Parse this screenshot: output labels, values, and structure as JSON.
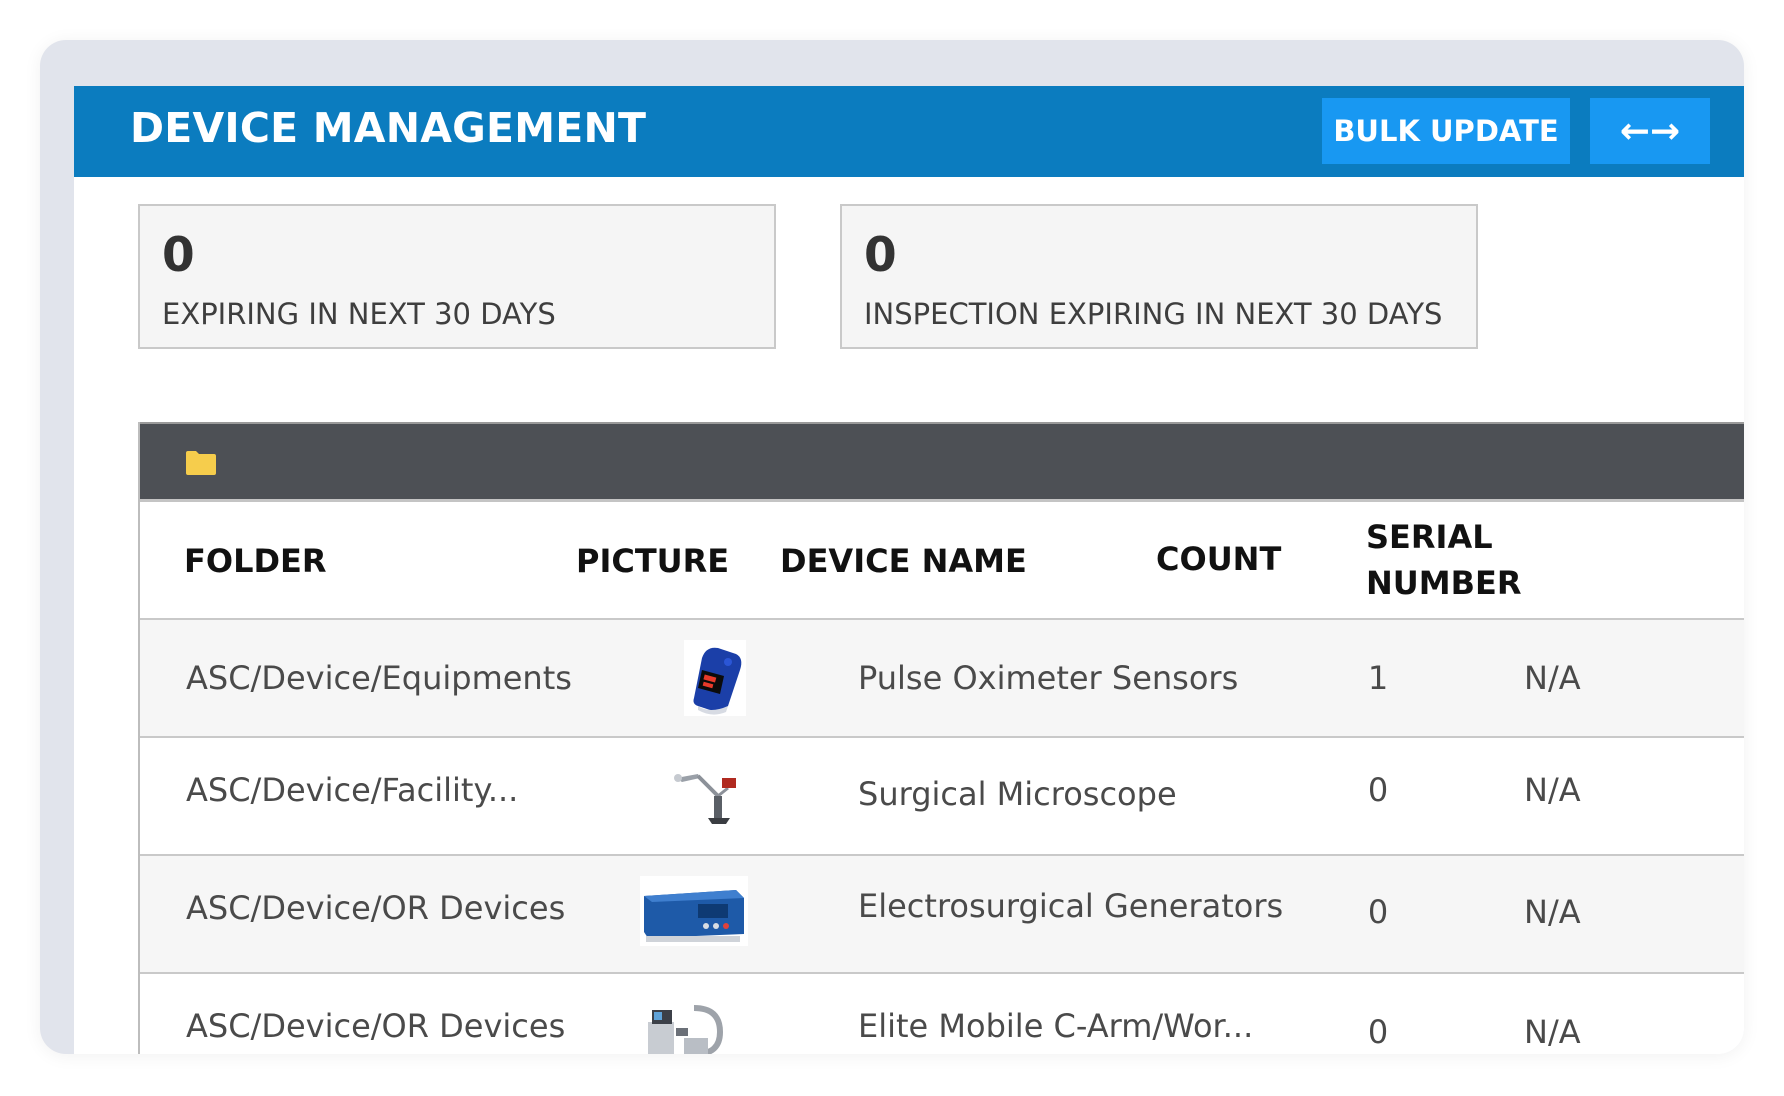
{
  "header": {
    "title": "DEVICE MANAGEMENT",
    "bulk_update_label": "BULK UPDATE",
    "expand_label": "←→"
  },
  "stats": [
    {
      "value": "0",
      "label": "EXPIRING IN NEXT 30 DAYS"
    },
    {
      "value": "0",
      "label": "INSPECTION EXPIRING IN NEXT 30 DAYS"
    }
  ],
  "table": {
    "columns": {
      "folder": "FOLDER",
      "picture": "PICTURE",
      "device_name": "DEVICE NAME",
      "count": "COUNT",
      "serial_line1": "SERIAL",
      "serial_line2": "NUMBER"
    },
    "rows": [
      {
        "folder": "ASC/Device/Equipments",
        "picture": "pulse-oximeter-image",
        "device_name": "Pulse Oximeter Sensors",
        "count": "1",
        "serial": "N/A"
      },
      {
        "folder": "ASC/Device/Facility...",
        "picture": "surgical-microscope-image",
        "device_name": "Surgical Microscope",
        "count": "0",
        "serial": "N/A"
      },
      {
        "folder": "ASC/Device/OR Devices",
        "picture": "electrosurgical-generator-image",
        "device_name": "Electrosurgical Generators",
        "count": "0",
        "serial": "N/A"
      },
      {
        "folder": "ASC/Device/OR Devices",
        "picture": "c-arm-image",
        "device_name": "Elite Mobile C-Arm/Wor...",
        "count": "0",
        "serial": "N/A"
      }
    ]
  },
  "colors": {
    "header_bg": "#0b7cbf",
    "button_bg": "#1898f2",
    "toolbar_bg": "#4d5055",
    "folder_icon": "#f6cd4c"
  }
}
